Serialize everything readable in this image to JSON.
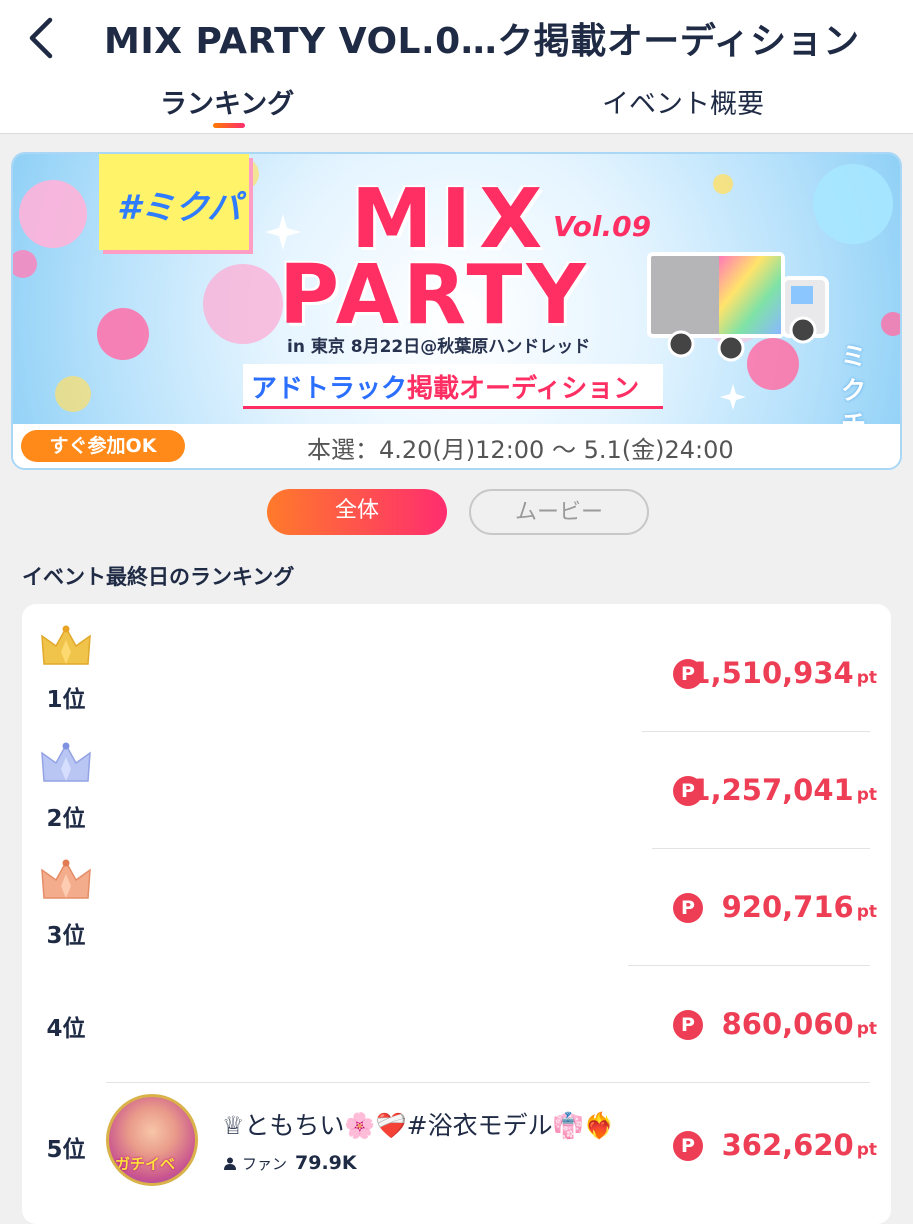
{
  "header": {
    "title": "MIX PARTY VOL.0…ク掲載オーディション",
    "back_icon": "chevron-left-icon",
    "tabs": [
      {
        "label": "ランキング",
        "active": true
      },
      {
        "label": "イベント概要",
        "active": false
      }
    ]
  },
  "banner": {
    "tag": "#ミクパ",
    "title_line1": "MIX",
    "volume": "Vol.09",
    "title_line2": "PARTY",
    "location": "in 東京  8月22日@秋葉原ハンドレッド",
    "subtitle_blue": "アドトラック",
    "subtitle_pink": "掲載オーディション",
    "side_label": "ミクチャ",
    "join_label": "すぐ参加OK",
    "period": "本選：4.20(月)12:00 〜 5.1(金)24:00"
  },
  "filters": {
    "all": "全体",
    "movie": "ムービー",
    "selected": "全体"
  },
  "ranking": {
    "section_title": "イベント最終日のランキング",
    "point_icon_label": "P",
    "unit": "pt",
    "rows": [
      {
        "rank": "1位",
        "points": "1,510,934",
        "crown": "gold"
      },
      {
        "rank": "2位",
        "points": "1,257,041",
        "crown": "silver"
      },
      {
        "rank": "3位",
        "points": "920,716",
        "crown": "bronze"
      },
      {
        "rank": "4位",
        "points": "860,060"
      },
      {
        "rank": "5位",
        "points": "362,620",
        "user_name": "♕ともちい🌸❤️‍🩹#浴衣モデル👘❤️‍🔥",
        "fan_label": "ファン",
        "fan_count": "79.9K",
        "avatar_text": "ガチイベ"
      }
    ]
  },
  "colors": {
    "accent_pink": "#ff2d6f",
    "accent_orange": "#ff7a2a",
    "points_red": "#ee3e55",
    "crown_gold": "#f0c44a",
    "crown_silver": "#a9b7ee",
    "crown_bronze": "#f2a07c"
  }
}
